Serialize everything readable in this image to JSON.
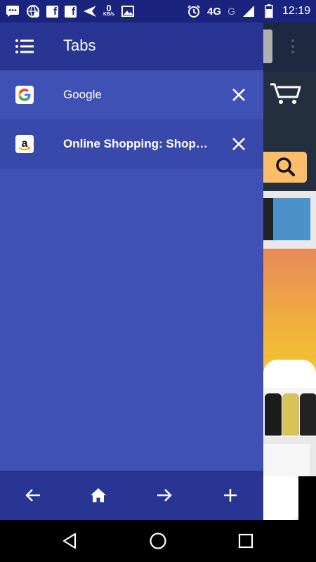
{
  "status_bar": {
    "speed_value": "0",
    "speed_unit": "KB/s",
    "network": "4G",
    "carrier_g": "G",
    "time": "12:19",
    "fb_letter": "f"
  },
  "drawer": {
    "title": "Tabs",
    "tabs": [
      {
        "title": "Google",
        "favicon": "google-g-icon",
        "active": false
      },
      {
        "title": "Online Shopping: Shop…",
        "favicon": "amazon-a-icon",
        "active": true
      }
    ]
  },
  "bottom_bar": {
    "icons": [
      "back-arrow-icon",
      "home-icon",
      "forward-arrow-icon",
      "plus-icon"
    ]
  },
  "system_nav": {
    "icons": [
      "back-triangle-icon",
      "home-circle-icon",
      "recents-square-icon"
    ]
  },
  "colors": {
    "drawer_bg": "#3f51b5",
    "header_bg": "#283593",
    "active_tab": "#3949ab",
    "status_bar": "#1a237e"
  }
}
